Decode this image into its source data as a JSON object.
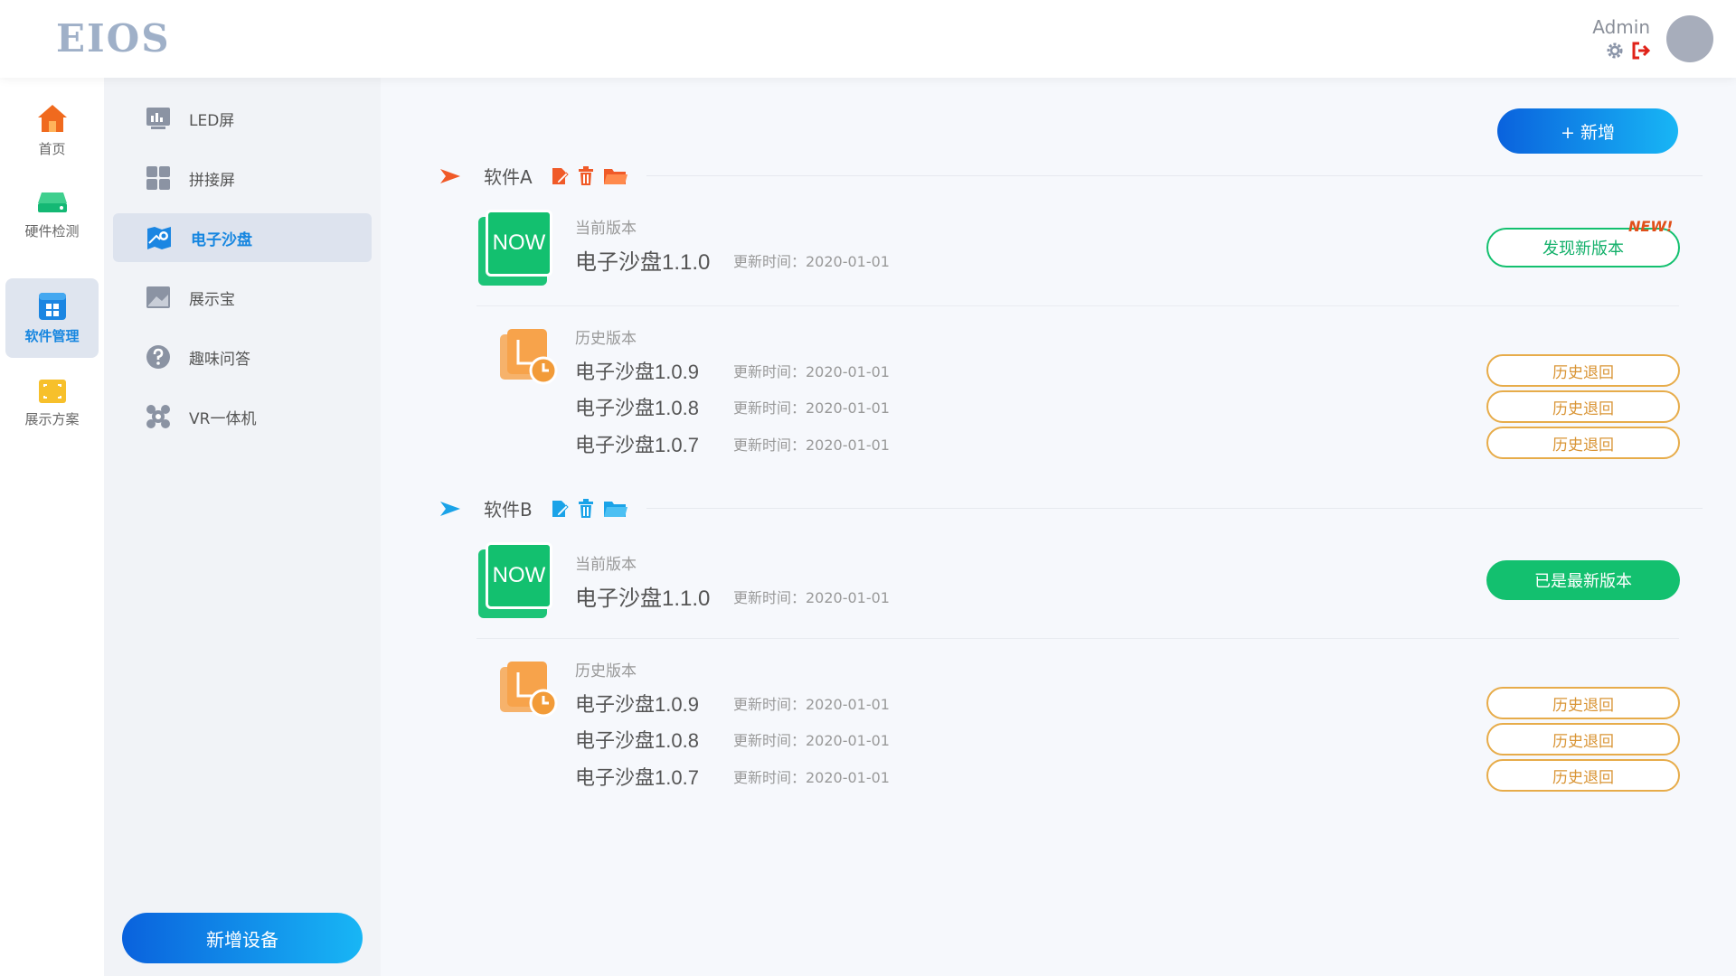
{
  "app": {
    "logo": "EIOS"
  },
  "header": {
    "user_name": "Admin"
  },
  "leftnav": {
    "items": [
      {
        "label": "首页",
        "icon": "home-icon"
      },
      {
        "label": "硬件检测",
        "icon": "hardware-icon"
      },
      {
        "label": "软件管理",
        "icon": "software-icon"
      },
      {
        "label": "展示方案",
        "icon": "display-plan-icon"
      }
    ],
    "active_index": 2
  },
  "subnav": {
    "items": [
      {
        "label": "LED屏",
        "icon": "led-screen-icon"
      },
      {
        "label": "拼接屏",
        "icon": "splice-screen-icon"
      },
      {
        "label": "电子沙盘",
        "icon": "sand-table-icon"
      },
      {
        "label": "展示宝",
        "icon": "showcase-icon"
      },
      {
        "label": "趣味问答",
        "icon": "question-icon"
      },
      {
        "label": "VR一体机",
        "icon": "vr-icon"
      }
    ],
    "active_index": 2,
    "add_device_label": "新增设备"
  },
  "main": {
    "add_label": "+ 新增",
    "sections": [
      {
        "title": "软件A",
        "accent": "#f05a28",
        "current_label": "当前版本",
        "now_text": "NOW",
        "current_version": "电子沙盘1.1.0",
        "current_update": "更新时间：2020-01-01",
        "action_label": "发现新版本",
        "badge": "NEW!",
        "history_label": "历史版本",
        "history": [
          {
            "version": "电子沙盘1.0.9",
            "update": "更新时间：2020-01-01",
            "action": "历史退回"
          },
          {
            "version": "电子沙盘1.0.8",
            "update": "更新时间：2020-01-01",
            "action": "历史退回"
          },
          {
            "version": "电子沙盘1.0.7",
            "update": "更新时间：2020-01-01",
            "action": "历史退回"
          }
        ]
      },
      {
        "title": "软件B",
        "accent": "#1aa3e8",
        "current_label": "当前版本",
        "now_text": "NOW",
        "current_version": "电子沙盘1.1.0",
        "current_update": "更新时间：2020-01-01",
        "action_label": "已是最新版本",
        "history_label": "历史版本",
        "history": [
          {
            "version": "电子沙盘1.0.9",
            "update": "更新时间：2020-01-01",
            "action": "历史退回"
          },
          {
            "version": "电子沙盘1.0.8",
            "update": "更新时间：2020-01-01",
            "action": "历史退回"
          },
          {
            "version": "电子沙盘1.0.7",
            "update": "更新时间：2020-01-01",
            "action": "历史退回"
          }
        ]
      }
    ]
  },
  "colors": {
    "primary": "#1686e0",
    "green": "#13c06f",
    "orange": "#e7ac4a",
    "red": "#e0231a"
  }
}
